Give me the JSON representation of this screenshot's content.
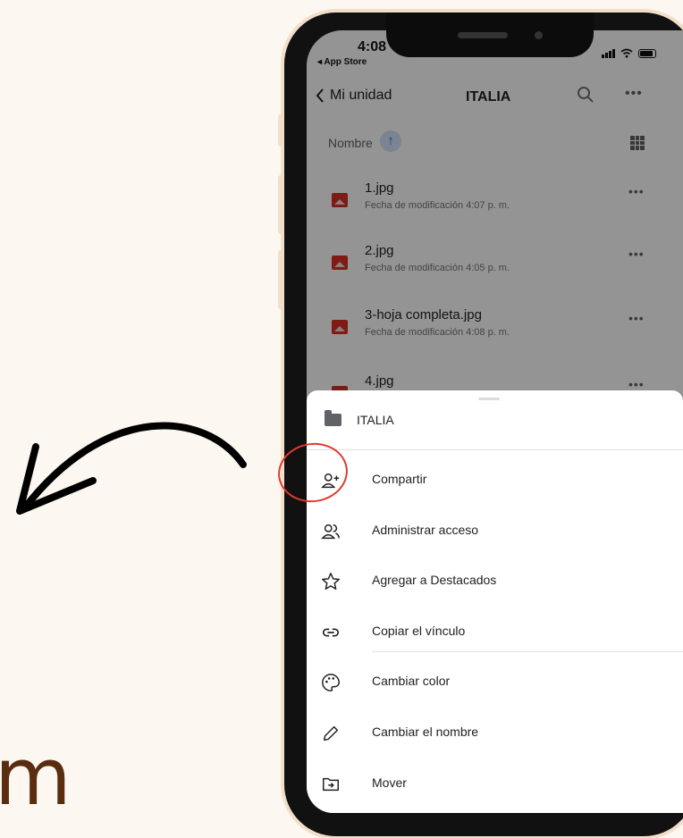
{
  "decor": {
    "letter": "m"
  },
  "status_bar": {
    "time": "4:08",
    "back_app": "◂ App Store"
  },
  "nav": {
    "back_label": "Mi unidad",
    "title": "ITALIA"
  },
  "sort": {
    "label": "Nombre",
    "arrow": "↑"
  },
  "files": [
    {
      "name": "1.jpg",
      "date": "Fecha de modificación 4:07 p. m."
    },
    {
      "name": "2.jpg",
      "date": "Fecha de modificación 4:05 p. m."
    },
    {
      "name": "3-hoja completa.jpg",
      "date": "Fecha de modificación 4:08 p. m."
    },
    {
      "name": "4.jpg",
      "date": ""
    }
  ],
  "sheet": {
    "title": "ITALIA",
    "items": [
      {
        "label": "Compartir",
        "icon": "person-add-icon"
      },
      {
        "label": "Administrar acceso",
        "icon": "people-icon"
      },
      {
        "label": "Agregar a Destacados",
        "icon": "star-icon"
      },
      {
        "label": "Copiar el vínculo",
        "icon": "link-icon"
      },
      {
        "label": "Cambiar color",
        "icon": "palette-icon"
      },
      {
        "label": "Cambiar el nombre",
        "icon": "pencil-icon"
      },
      {
        "label": "Mover",
        "icon": "move-folder-icon"
      }
    ]
  },
  "colors": {
    "accent": "#1a73e8",
    "file_icon": "#d93025",
    "highlight": "#e03a2e",
    "background": "#fdf7f2"
  }
}
